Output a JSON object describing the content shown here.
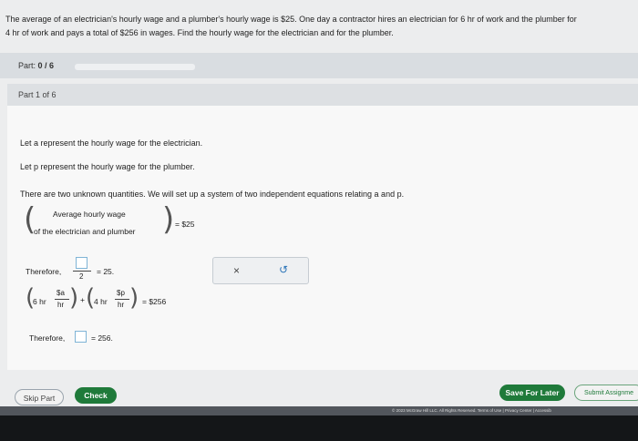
{
  "problem": {
    "text_line1": "The average of an electrician's hourly wage and a plumber's hourly wage is $25. One day a contractor hires an electrician for 6 hr of work and the plumber for",
    "text_line2": "4 hr of work and pays a total of $256 in wages. Find the hourly wage for the electrician and for the plumber."
  },
  "part": {
    "label": "Part:",
    "value": "0 / 6",
    "progress_fraction": 0
  },
  "section": {
    "title": "Part 1 of 6"
  },
  "content": {
    "let_a": "Let a represent the hourly wage for the electrician.",
    "let_p": "Let p represent the hourly wage for the plumber.",
    "two_unknowns": "There are two unknown quantities. We will set up a system of two independent equations relating a and p.",
    "avg_line1": "Average hourly wage",
    "avg_line2": "of the electrician and plumber",
    "eq_rhs1": "= $25",
    "therefore1": "Therefore,",
    "frac_den": "2",
    "eq_rhs2": "= 25.",
    "six_hr": "6 hr",
    "sa_num": "$a",
    "sa_den": "hr",
    "plus": "+",
    "four_hr": "4 hr",
    "sp_num": "$p",
    "sp_den": "hr",
    "eq_rhs3": "= $256",
    "therefore2": "Therefore,",
    "eq_rhs4": "= 256."
  },
  "actions": {
    "clear_icon": "×",
    "undo_icon": "↺"
  },
  "buttons": {
    "skip": "Skip Part",
    "check": "Check",
    "save": "Save For Later",
    "submit": "Submit Assignme"
  },
  "footer": {
    "text": "© 2023 McGraw Hill LLC. All Rights Reserved.   Terms of Use  |  Privacy Center  |  Accessib"
  },
  "colors": {
    "accent_green": "#1f7a3a",
    "input_border": "#7fb4d6"
  }
}
